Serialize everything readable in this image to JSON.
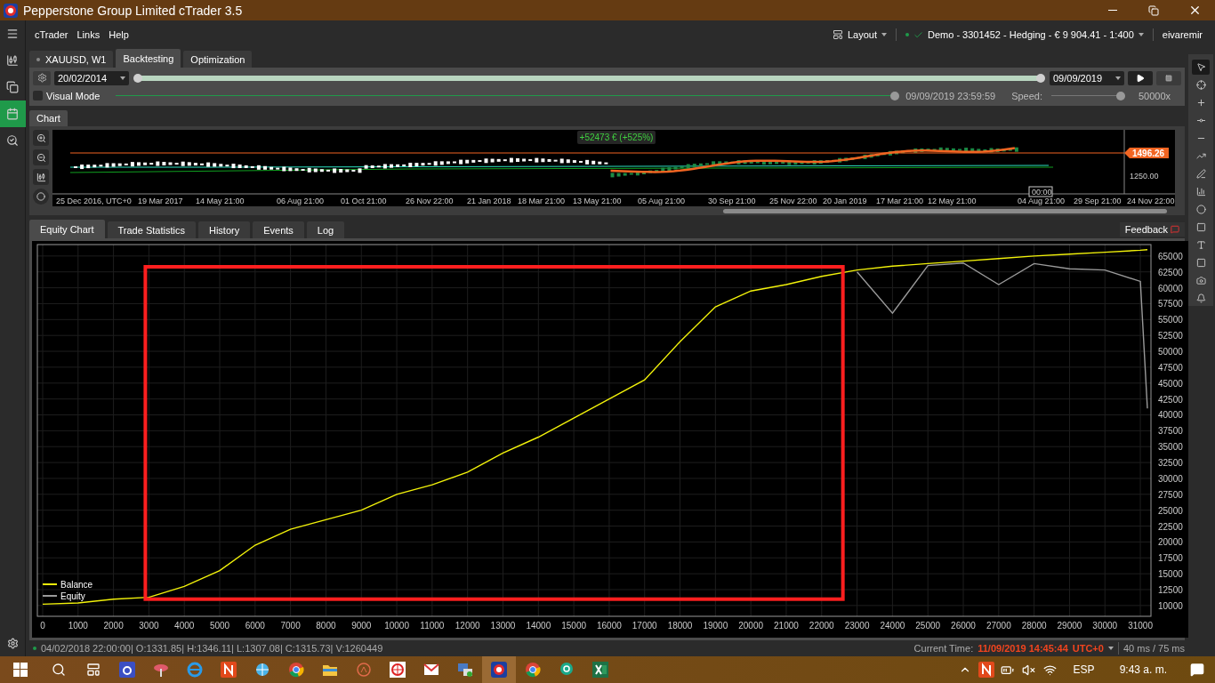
{
  "window": {
    "title": "Pepperstone Group Limited cTrader 3.5"
  },
  "side_nav": [
    {
      "kind": "menu",
      "selected": false
    },
    {
      "kind": "chart",
      "selected": false
    },
    {
      "kind": "copy",
      "selected": false
    },
    {
      "kind": "calendar",
      "selected": true
    },
    {
      "kind": "search",
      "selected": false
    }
  ],
  "menu": [
    "cTrader",
    "Links",
    "Help"
  ],
  "header_right": {
    "layout": "Layout",
    "account_status": "Demo",
    "account": "- 3301452 - Hedging - € 9 904.41 - 1:400",
    "user": "eivaremir"
  },
  "doc_tabs": [
    {
      "label": "XAUUSD, W1",
      "selected": false
    },
    {
      "label": "Backtesting",
      "selected": true
    },
    {
      "label": "Optimization",
      "selected": false
    }
  ],
  "backtest": {
    "start_date": "20/02/2014",
    "end_date": "09/09/2019",
    "range": {
      "level": 1
    },
    "visual_mode": {
      "label": "Visual Mode",
      "checked": false
    },
    "progress": {
      "level": 1,
      "time": "09/09/2019 23:59:59"
    },
    "speed": {
      "label": "Speed:",
      "level": 1,
      "value": "50000x"
    }
  },
  "chart_tab": {
    "label": "Chart",
    "selected": true
  },
  "mini_chart": {
    "profit": "+52473 € (+525%)",
    "price": "1496.26",
    "axis_label": "1250.00",
    "cursor_time": "00:00",
    "x_labels": [
      "25 Dec 2016, UTC+0",
      "19 Mar 2017",
      "14 May 21:00",
      "06 Aug 21:00",
      "01 Oct 21:00",
      "26 Nov 22:00",
      "21 Jan 2018",
      "18 Mar 21:00",
      "13 May 21:00",
      "05 Aug 21:00",
      "30 Sep 21:00",
      "25 Nov 22:00",
      "20 Jan 2019",
      "17 Mar 21:00",
      "12 May 21:00",
      "04 Aug 21:00",
      "29 Sep 21:00",
      "24 Nov 22:00"
    ]
  },
  "result_tabs": [
    {
      "label": "Equity Chart",
      "selected": true
    },
    {
      "label": "Trade Statistics",
      "selected": false
    },
    {
      "label": "History",
      "selected": false
    },
    {
      "label": "Events",
      "selected": false
    },
    {
      "label": "Log",
      "selected": false
    }
  ],
  "feedback": "Feedback",
  "equity_chart": {
    "highlight_box": {
      "color": "#ff1f1f"
    },
    "chart_data": {
      "type": "line",
      "grid": true,
      "legend": true,
      "x": [
        0,
        1000,
        2000,
        3000,
        4000,
        5000,
        6000,
        7000,
        8000,
        9000,
        10000,
        11000,
        12000,
        13000,
        14000,
        15000,
        16000,
        17000,
        18000,
        19000,
        20000,
        21000,
        22000,
        23000,
        24000,
        25000,
        26000,
        27000,
        28000,
        29000,
        30000,
        31000,
        31200
      ],
      "series": [
        {
          "name": "Balance",
          "color": "#f2f20a",
          "values": [
            10200,
            10400,
            11000,
            11300,
            13000,
            15500,
            19500,
            22000,
            23500,
            25000,
            27500,
            29000,
            31000,
            34000,
            36500,
            39500,
            42500,
            45500,
            51500,
            57000,
            59500,
            60500,
            61800,
            62800,
            63400,
            63800,
            64200,
            64600,
            65000,
            65300,
            65600,
            65900,
            66000
          ]
        },
        {
          "name": "Equity",
          "color": "#9a9a9a",
          "values": [
            null,
            null,
            null,
            null,
            null,
            null,
            null,
            null,
            null,
            null,
            null,
            null,
            null,
            null,
            null,
            null,
            null,
            null,
            null,
            null,
            null,
            null,
            null,
            62500,
            56000,
            63500,
            63900,
            60500,
            63800,
            63000,
            62800,
            61000,
            41000
          ]
        }
      ],
      "xlim": [
        -150,
        31300
      ],
      "ylim": [
        8300,
        66800
      ],
      "xticks": [
        0,
        1000,
        2000,
        3000,
        4000,
        5000,
        6000,
        7000,
        8000,
        9000,
        10000,
        11000,
        12000,
        13000,
        14000,
        15000,
        16000,
        17000,
        18000,
        19000,
        20000,
        21000,
        22000,
        23000,
        24000,
        25000,
        26000,
        27000,
        28000,
        29000,
        30000,
        31000
      ],
      "yticks": [
        10000,
        12500,
        15000,
        17500,
        20000,
        22500,
        25000,
        27500,
        30000,
        32500,
        35000,
        37500,
        40000,
        42500,
        45000,
        47500,
        50000,
        52500,
        55000,
        57500,
        60000,
        62500,
        65000
      ]
    }
  },
  "status_bar": {
    "bar_info": "04/02/2018 22:00:00| O:1331.85| H:1346.11| L:1307.08| C:1315.73| V:1260449",
    "current_time_label": "Current Time:",
    "current_time": "11/09/2019 14:45:44",
    "timezone": "UTC+0",
    "latency": "40 ms / 75 ms"
  },
  "taskbar": {
    "apps": [
      {
        "kind": "a",
        "selected": false
      },
      {
        "kind": "pin",
        "selected": false
      },
      {
        "kind": "ie",
        "selected": false
      },
      {
        "kind": "news",
        "selected": false
      },
      {
        "kind": "globe",
        "selected": false
      },
      {
        "kind": "chrome",
        "selected": false
      },
      {
        "kind": "folder",
        "selected": false
      },
      {
        "kind": "ring",
        "selected": false
      },
      {
        "kind": "target",
        "selected": false
      },
      {
        "kind": "mail",
        "selected": false
      },
      {
        "kind": "remote",
        "selected": false
      },
      {
        "kind": "ctrader",
        "selected": true
      },
      {
        "kind": "chrome",
        "selected": false
      },
      {
        "kind": "chat",
        "selected": false
      },
      {
        "kind": "excel",
        "selected": false
      }
    ],
    "language": "ESP",
    "clock": "9:43 a. m."
  }
}
